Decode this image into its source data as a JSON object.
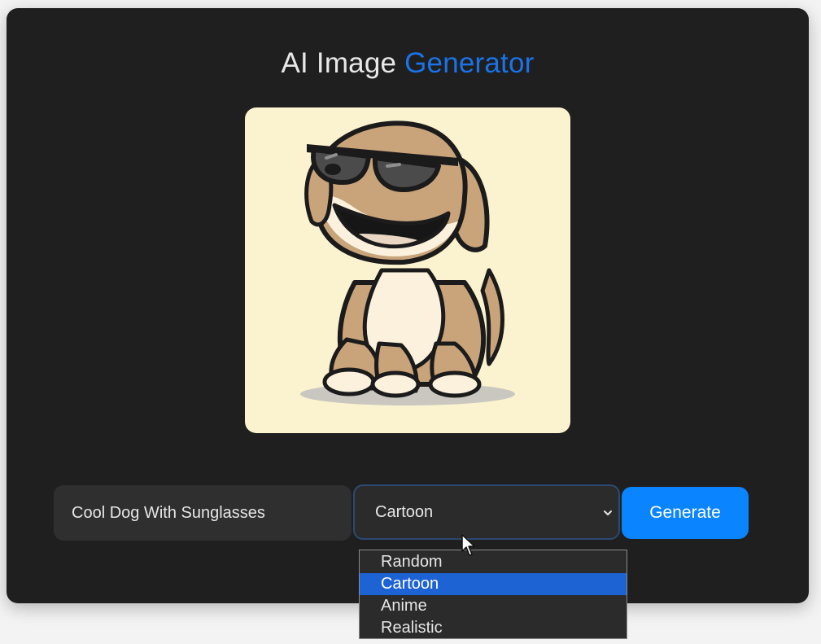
{
  "header": {
    "title_main": "AI Image",
    "title_accent": "Generator",
    "accent_color": "#1a73e8"
  },
  "image": {
    "alt": "Cool Dog With Sunglasses"
  },
  "form": {
    "prompt_value": "Cool Dog With Sunglasses",
    "style_selected": "Cartoon",
    "style_options": [
      "Random",
      "Cartoon",
      "Anime",
      "Realistic"
    ],
    "generate_label": "Generate",
    "button_color": "#0a84ff"
  },
  "icons": {
    "select": "chevron-down-icon",
    "pointer": "mouse-cursor-icon"
  }
}
